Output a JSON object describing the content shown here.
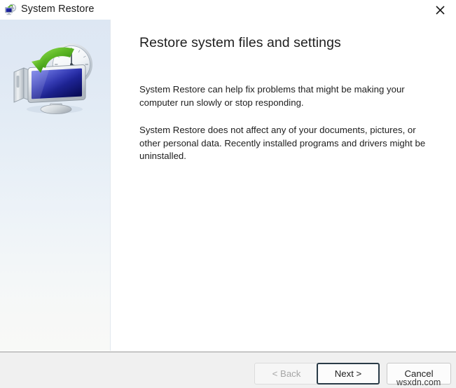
{
  "window": {
    "title": "System Restore",
    "title_icon": "system-restore-icon",
    "close_icon": "close-icon"
  },
  "sidebar": {
    "illustration": "monitor-clock-restore-illustration"
  },
  "main": {
    "heading": "Restore system files and settings",
    "paragraphs": [
      "System Restore can help fix problems that might be making your computer run slowly or stop responding.",
      "System Restore does not affect any of your documents, pictures, or other personal data. Recently installed programs and drivers might be uninstalled."
    ]
  },
  "footer": {
    "back_label": "< Back",
    "back_disabled": true,
    "next_label": "Next >",
    "next_focused": true,
    "cancel_label": "Cancel"
  },
  "watermark": {
    "text": "wsxdn.com"
  },
  "colors": {
    "window_background": "#ffffff",
    "sidebar_gradient_top": "#dde7f3",
    "sidebar_gradient_bottom": "#f8f9f7",
    "footer_background": "#f0f0f0",
    "footer_divider": "#9a9a9a",
    "text_primary": "#1d1d1d",
    "text_disabled": "#a6a6a6",
    "focus_border": "#2a3b47",
    "accent_green": "#5cb82a",
    "screen_blue": "#1a1fb0"
  }
}
